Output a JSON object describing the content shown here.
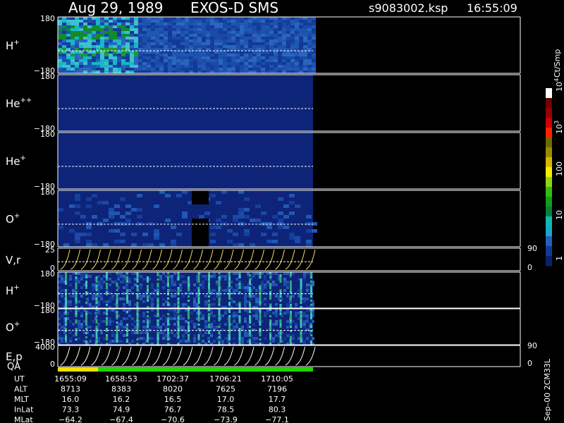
{
  "header": {
    "date": "Aug 29, 1989",
    "instrument": "EXOS-D SMS",
    "file": "s9083002.ksp",
    "time": "16:55:09"
  },
  "colorbar": {
    "title": "Ct/Smp",
    "ticks": [
      "1",
      "10",
      "100",
      "10",
      "10"
    ],
    "tick_exponents": [
      "",
      "",
      "",
      "3",
      "4"
    ],
    "colors": [
      "#0b1f6b",
      "#123a94",
      "#1f5fbf",
      "#1aa6c8",
      "#10b8b0",
      "#0a7f3a",
      "#139c1e",
      "#33bb14",
      "#8fd414",
      "#f0f000",
      "#d9b500",
      "#9a8a00",
      "#6b6b00",
      "#ff2000",
      "#cc0000",
      "#990000",
      "#700000",
      "#ffffff"
    ]
  },
  "chart_data": {
    "type": "heatmap",
    "time_axis": {
      "label": "UT",
      "ticks": [
        "1655:09",
        "1658:53",
        "1702:37",
        "1706:21",
        "1710:05"
      ]
    },
    "panels": [
      {
        "label": "H",
        "sup": "+",
        "ymax": "180",
        "ymin": "−180",
        "pattern": "h_plus"
      },
      {
        "label": "He",
        "sup": "++",
        "ymax": "180",
        "ymin": "−180",
        "pattern": "dark"
      },
      {
        "label": "He",
        "sup": "+",
        "ymax": "180",
        "ymin": "−180",
        "pattern": "dark"
      },
      {
        "label": "O",
        "sup": "+",
        "ymax": "180",
        "ymin": "−180",
        "pattern": "o_plus"
      },
      {
        "label": "V,r",
        "sup": "",
        "ymax": "25",
        "ymin": "0",
        "right_max": "90",
        "right_min": "0",
        "pattern": "lines_v"
      },
      {
        "label": "H",
        "sup": "+",
        "ymax": "180",
        "ymin": "−180",
        "pattern": "stripes"
      },
      {
        "label": "O",
        "sup": "+",
        "ymax": "180",
        "ymin": "−180",
        "pattern": "stripes"
      },
      {
        "label": "E,p",
        "sup": "",
        "ymax": "4000",
        "ymin": "0",
        "right_max": "90",
        "right_min": "0",
        "pattern": "lines_e"
      }
    ],
    "qa_label": "QA",
    "ephemeris": [
      {
        "name": "UT",
        "values": [
          "1655:09",
          "1658:53",
          "1702:37",
          "1706:21",
          "1710:05"
        ]
      },
      {
        "name": "ALT",
        "values": [
          "8713",
          "8383",
          "8020",
          "7625",
          "7196"
        ]
      },
      {
        "name": "MLT",
        "values": [
          "16.0",
          "16.2",
          "16.5",
          "17.0",
          "17.7"
        ]
      },
      {
        "name": "InLat",
        "values": [
          "73.3",
          "74.9",
          "76.7",
          "78.5",
          "80.3"
        ]
      },
      {
        "name": "MLat",
        "values": [
          "−64.2",
          "−67.4",
          "−70.6",
          "−73.9",
          "−77.1"
        ]
      }
    ]
  },
  "footer": {
    "version": "Sep–00 2CM33L"
  }
}
